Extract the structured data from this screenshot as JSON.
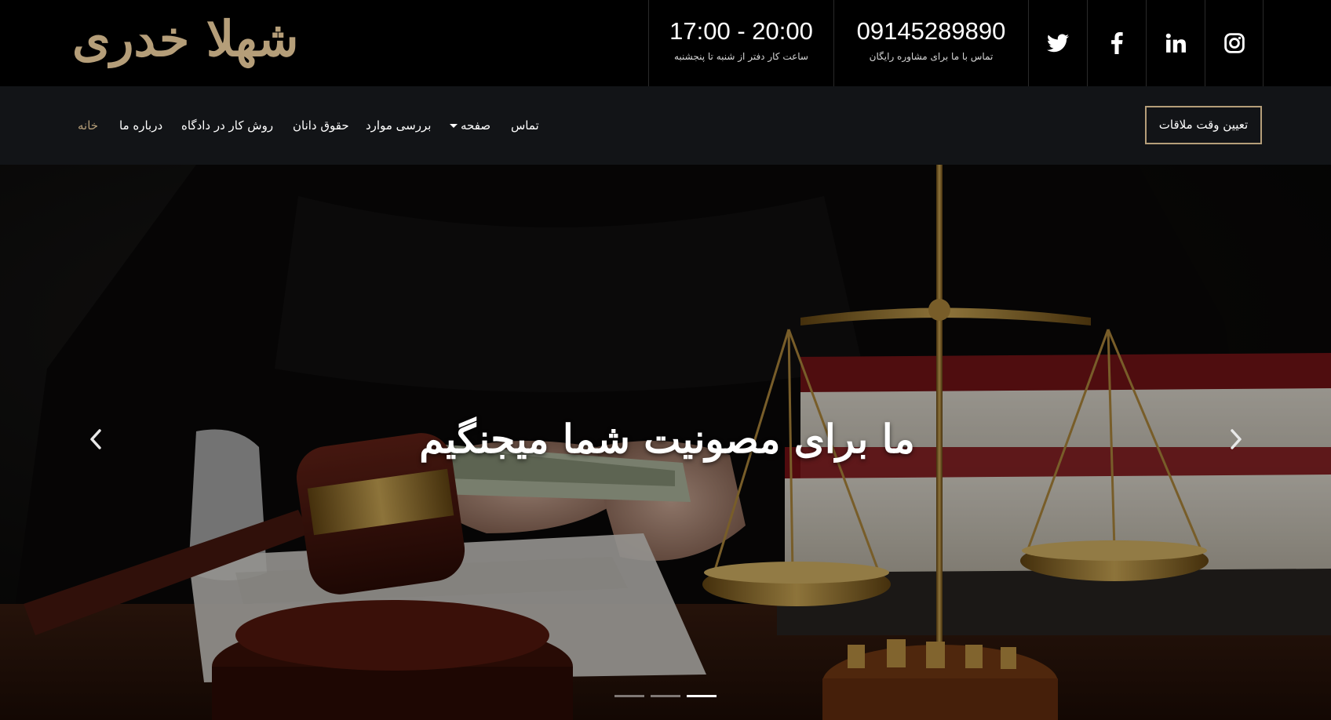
{
  "brand": {
    "name": "شهلا خدری",
    "color": "#b59e79"
  },
  "topbar": {
    "hours": {
      "value": "17:00 - 20:00",
      "caption": "ساعت کار دفتر از شنبه تا پنجشنبه"
    },
    "phone": {
      "value": "09145289890",
      "caption": "تماس با ما برای مشاوره رایگان"
    },
    "social": [
      {
        "icon": "twitter-icon"
      },
      {
        "icon": "facebook-icon"
      },
      {
        "icon": "linkedin-icon"
      },
      {
        "icon": "instagram-icon"
      }
    ]
  },
  "nav": {
    "appointment_button": "تعیین وقت ملاقات",
    "items": [
      {
        "label": "خانه",
        "active": true
      },
      {
        "label": "درباره ما"
      },
      {
        "label": "روش کار در دادگاه"
      },
      {
        "label": "حقوق دانان"
      },
      {
        "label": "بررسی موارد"
      },
      {
        "label": "صفحه",
        "dropdown": true
      },
      {
        "label": "تماس"
      }
    ]
  },
  "hero": {
    "title": "ما برای مصونیت شما میجنگیم",
    "slides_count": 3,
    "active_slide": 3,
    "prev_icon": "chevron-left-icon",
    "next_icon": "chevron-right-icon"
  },
  "colors": {
    "accent": "#b59e79",
    "topbar_bg": "#000000",
    "navbar_bg": "#121417"
  }
}
